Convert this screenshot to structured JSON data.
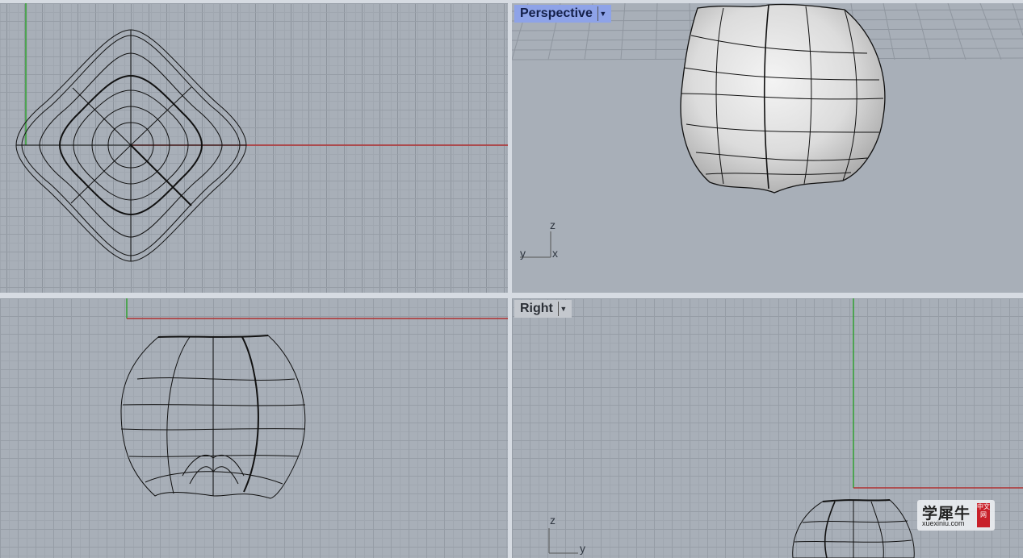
{
  "viewports": {
    "top": {
      "label": ""
    },
    "perspective": {
      "label": "Perspective",
      "active": true
    },
    "front": {
      "label": ""
    },
    "right": {
      "label": "Right"
    }
  },
  "axes": {
    "perspective": {
      "a": "z",
      "b": "y",
      "c": "x"
    },
    "right": {
      "a": "z",
      "b": "y"
    }
  },
  "dropdown_icon": "triangle-down-icon",
  "colors": {
    "x_axis": "#b03030",
    "y_axis": "#30a030",
    "active_label": "#8ea3e8"
  },
  "watermark": {
    "main": "学犀牛",
    "sub": "xuexiniu.com",
    "seal": "中文网"
  }
}
